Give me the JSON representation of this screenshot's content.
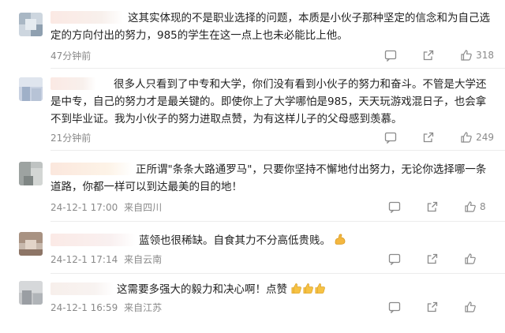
{
  "comments": [
    {
      "nickname_suffix": "：",
      "text": "这其实体现的不是职业选择的问题，本质是小伙子那种坚定的信念和为自己选定的方向付出的努力，985的学生在这一点上也未必能比上他。",
      "time": "47分钟前",
      "location": "",
      "likes": "318"
    },
    {
      "nickname_suffix": "：",
      "text": "很多人只看到了中专和大学，你们没有看到小伙子的努力和奋斗。不管是大学还是中专，自己的努力才是最关键的。即使你上了大学哪怕是985，天天玩游戏混日子，也会拿不到毕业证。我为小伙子的努力进取点赞，为有这样儿子的父母感到羡慕。",
      "time": "21分钟前",
      "location": "",
      "likes": "249"
    },
    {
      "nickname_suffix": "",
      "text": "正所谓\"条条大路通罗马\"，只要你坚持不懈地付出努力，无论你选择哪一条道路，你都一样可以到达最美的目的地！",
      "time": "24-12-1 17:00",
      "location": "来自四川",
      "likes": "8"
    },
    {
      "nickname_suffix": "",
      "text": "蓝领也很稀缺。自食其力不分高低贵贱。",
      "time": "24-12-1 17:14",
      "location": "来自云南",
      "likes": ""
    },
    {
      "nickname_suffix": "",
      "text": "这需要多强大的毅力和决心啊！点赞",
      "time": "24-12-1 16:59",
      "location": "来自江苏",
      "likes": ""
    }
  ],
  "icons": {
    "reply": "reply-icon",
    "share": "share-icon",
    "like": "thumbs-up-icon",
    "flex": "flexed-arm-emoji",
    "thumb": "thumbs-up-emoji"
  },
  "colors": {
    "meta": "#8a8a8a",
    "divider": "#ececec",
    "text": "#222222"
  }
}
